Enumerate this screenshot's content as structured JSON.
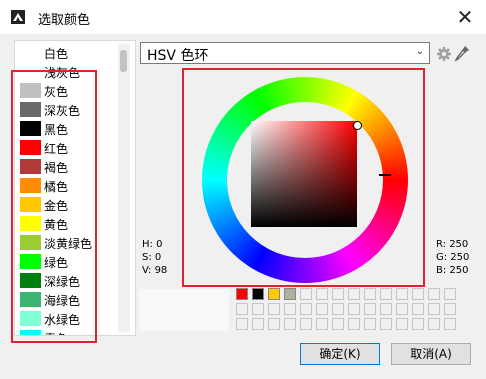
{
  "window": {
    "title": "选取颜色",
    "close_symbol": "✕"
  },
  "color_list": {
    "items": [
      {
        "label": "白色",
        "color": ""
      },
      {
        "label": "浅灰色",
        "color": ""
      },
      {
        "label": "灰色",
        "color": "#c0c0c0"
      },
      {
        "label": "深灰色",
        "color": "#696969"
      },
      {
        "label": "黑色",
        "color": "#000000"
      },
      {
        "label": "红色",
        "color": "#ff0000"
      },
      {
        "label": "褐色",
        "color": "#b03a3a"
      },
      {
        "label": "橘色",
        "color": "#ff8c00"
      },
      {
        "label": "金色",
        "color": "#ffc800"
      },
      {
        "label": "黄色",
        "color": "#ffff00"
      },
      {
        "label": "淡黄绿色",
        "color": "#9acd32"
      },
      {
        "label": "绿色",
        "color": "#00ff00"
      },
      {
        "label": "深绿色",
        "color": "#007f0e"
      },
      {
        "label": "海绿色",
        "color": "#3cb371"
      },
      {
        "label": "水绿色",
        "color": "#7fffd4"
      },
      {
        "label": "青色",
        "color": "#00ffff"
      }
    ]
  },
  "mode": {
    "label": "HSV 色环",
    "chevron": "⌄"
  },
  "icons": {
    "settings": "gear-icon",
    "eyedropper": "eyedropper-icon",
    "app": "color-picker-app-icon"
  },
  "readouts": {
    "h": "H: 0",
    "s": "S: 0",
    "v": "V: 98",
    "r": "R: 250",
    "g": "G: 250",
    "b": "B: 250"
  },
  "recent_colors": [
    "#ff0000",
    "#000000",
    "#ffc800",
    "#b0b0a0"
  ],
  "buttons": {
    "ok": "确定(K)",
    "cancel": "取消(A)"
  },
  "accent": "#0078d7",
  "highlight": "#e0232f"
}
